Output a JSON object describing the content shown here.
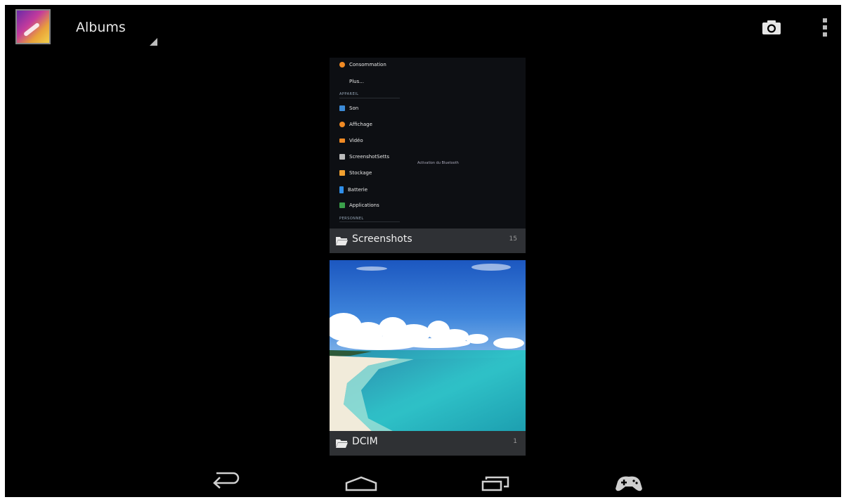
{
  "action_bar": {
    "title": "Albums"
  },
  "icons": {
    "app": "gallery-app-icon",
    "camera": "camera-icon",
    "overflow": "overflow-menu-icon",
    "folder": "folder-icon",
    "back": "back-icon",
    "home": "home-icon",
    "recents": "recent-apps-icon",
    "games": "gamepad-icon"
  },
  "albums": [
    {
      "name": "Screenshots",
      "count": "15",
      "preview": {
        "rows": [
          {
            "label": "Consommation",
            "icon_color": "#f08a24"
          },
          {
            "label": "Plus..."
          },
          {
            "header": "APPAREIL"
          },
          {
            "label": "Son",
            "icon_color": "#3c8ad6"
          },
          {
            "label": "Affichage",
            "icon_color": "#f08a24"
          },
          {
            "label": "Vidéo",
            "icon_color": "#f08a24"
          },
          {
            "label": "ScreenshotSetts",
            "icon_color": "#bbbbbb"
          },
          {
            "label": "Stockage",
            "icon_color": "#f0a030"
          },
          {
            "label": "Batterie",
            "icon_color": "#2f8ee8"
          },
          {
            "label": "Applications",
            "icon_color": "#3aa04a"
          },
          {
            "header": "PERSONNEL"
          }
        ],
        "right_text": "Activation du Bluetooth"
      }
    },
    {
      "name": "DCIM",
      "count": "1"
    }
  ]
}
